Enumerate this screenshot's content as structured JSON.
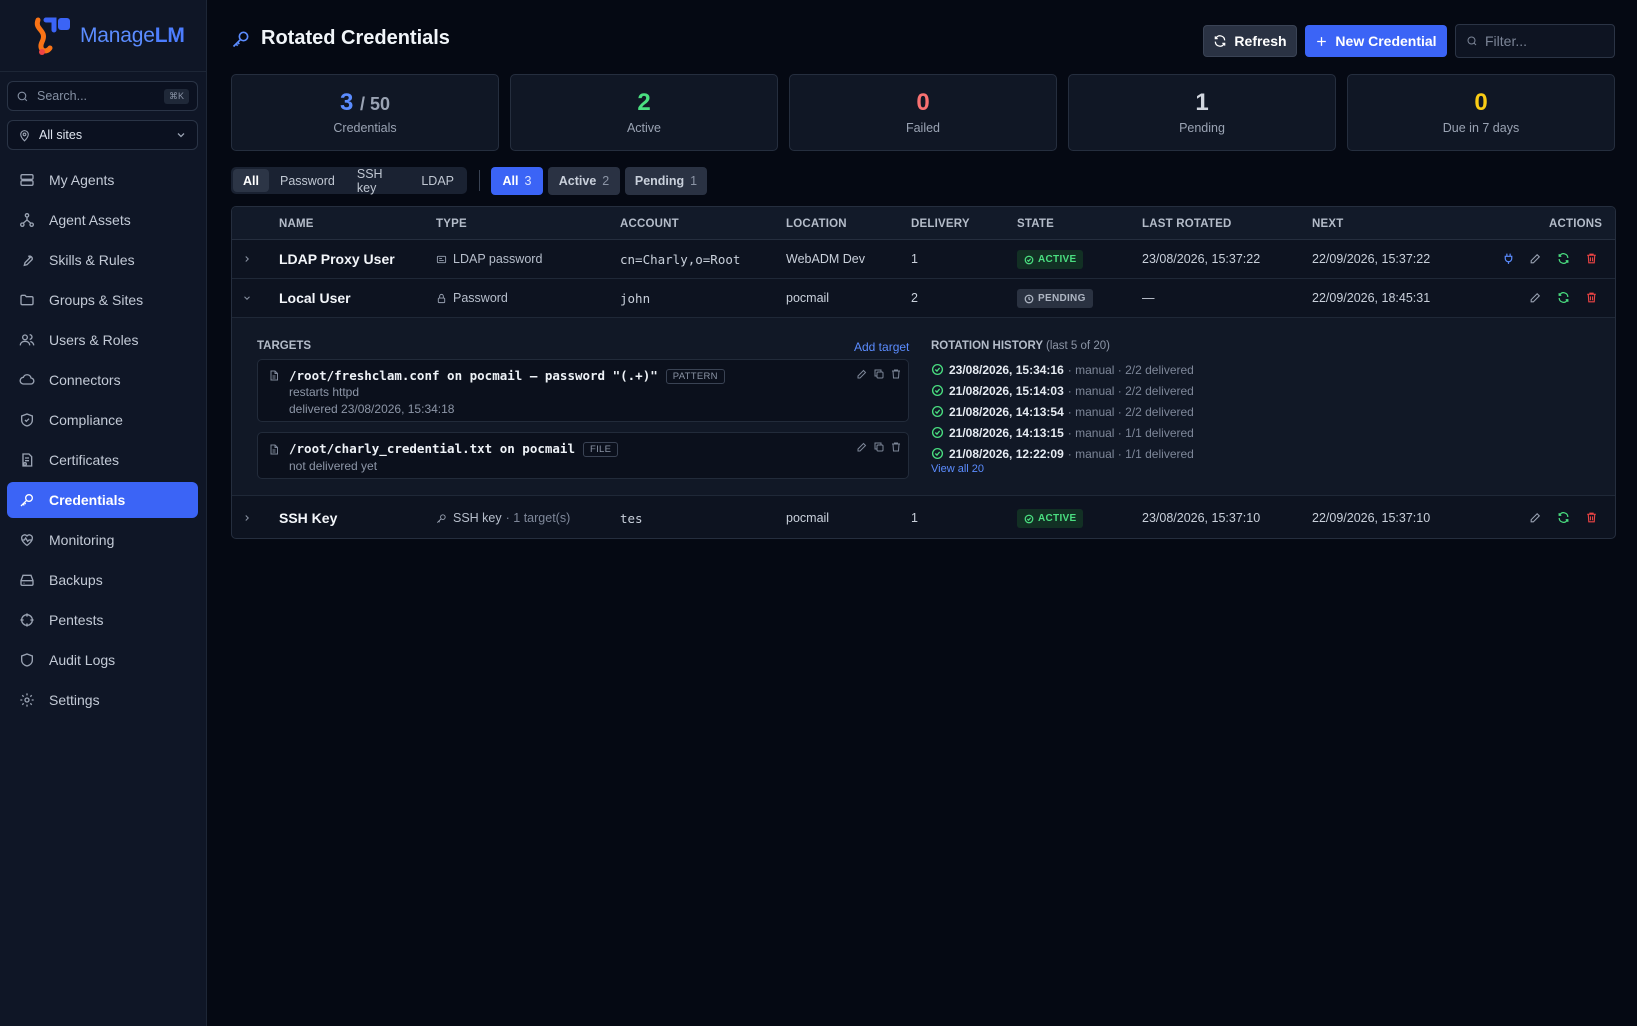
{
  "brand": {
    "name_prefix": "Manage",
    "name_suffix": "LM"
  },
  "sidebar": {
    "search_placeholder": "Search...",
    "search_shortcut": "⌘K",
    "site_select": "All sites",
    "items": [
      {
        "label": "My Agents",
        "icon": "server-icon"
      },
      {
        "label": "Agent Assets",
        "icon": "assets-icon"
      },
      {
        "label": "Skills & Rules",
        "icon": "wrench-icon"
      },
      {
        "label": "Groups & Sites",
        "icon": "folder-icon"
      },
      {
        "label": "Users & Roles",
        "icon": "users-icon"
      },
      {
        "label": "Connectors",
        "icon": "cloud-icon"
      },
      {
        "label": "Compliance",
        "icon": "shield-check-icon"
      },
      {
        "label": "Certificates",
        "icon": "certificate-icon"
      },
      {
        "label": "Credentials",
        "icon": "key-icon",
        "active": true
      },
      {
        "label": "Monitoring",
        "icon": "heart-pulse-icon"
      },
      {
        "label": "Backups",
        "icon": "hard-drive-icon"
      },
      {
        "label": "Pentests",
        "icon": "crosshair-icon"
      },
      {
        "label": "Audit Logs",
        "icon": "shield-icon"
      },
      {
        "label": "Settings",
        "icon": "gear-icon"
      }
    ]
  },
  "header": {
    "title": "Rotated Credentials",
    "refresh_label": "Refresh",
    "new_label": "New Credential",
    "filter_placeholder": "Filter..."
  },
  "stats": [
    {
      "value": "3",
      "suffix": "/ 50",
      "label": "Credentials",
      "color": "#5b8cff"
    },
    {
      "value": "2",
      "label": "Active",
      "color": "#4ade80"
    },
    {
      "value": "0",
      "label": "Failed",
      "color": "#f87171"
    },
    {
      "value": "1",
      "label": "Pending",
      "color": "#d1d6de"
    },
    {
      "value": "0",
      "label": "Due in 7 days",
      "color": "#facc15"
    }
  ],
  "type_filters": [
    "All",
    "Password",
    "SSH key",
    "LDAP"
  ],
  "state_filters": [
    {
      "label": "All",
      "count": "3"
    },
    {
      "label": "Active",
      "count": "2"
    },
    {
      "label": "Pending",
      "count": "1"
    }
  ],
  "table": {
    "columns": [
      "NAME",
      "TYPE",
      "ACCOUNT",
      "LOCATION",
      "DELIVERY",
      "STATE",
      "LAST ROTATED",
      "NEXT",
      "ACTIONS"
    ],
    "rows": [
      {
        "name": "LDAP Proxy User",
        "type": "LDAP password",
        "type_extra": "",
        "account": "cn=Charly,o=Root",
        "location": "WebADM Dev",
        "delivery": "1",
        "state": "ACTIVE",
        "last_rotated": "23/08/2026, 15:37:22",
        "next": "22/09/2026, 15:37:22"
      },
      {
        "name": "Local User",
        "type": "Password",
        "type_extra": "",
        "account": "john",
        "location": "pocmail",
        "delivery": "2",
        "state": "PENDING",
        "last_rotated": "—",
        "next": "22/09/2026, 18:45:31"
      },
      {
        "name": "SSH Key",
        "type": "SSH key",
        "type_extra": "· 1 target(s)",
        "account": "tes",
        "location": "pocmail",
        "delivery": "1",
        "state": "ACTIVE",
        "last_rotated": "23/08/2026, 15:37:10",
        "next": "22/09/2026, 15:37:10"
      }
    ]
  },
  "expanded": {
    "targets_title": "TARGETS",
    "add_target_label": "Add target",
    "targets": [
      {
        "path": "/root/freshclam.conf on pocmail — password \"(.+)\"",
        "tag": "PATTERN",
        "lines": [
          "restarts httpd",
          "delivered 23/08/2026, 15:34:18"
        ]
      },
      {
        "path": "/root/charly_credential.txt on pocmail",
        "tag": "FILE",
        "lines": [
          "not delivered yet"
        ]
      }
    ],
    "history_title": "ROTATION HISTORY",
    "history_sub": "(last 5 of 20)",
    "history": [
      {
        "time": "23/08/2026, 15:34:16",
        "detail": "· manual · 2/2 delivered"
      },
      {
        "time": "21/08/2026, 15:14:03",
        "detail": "· manual · 2/2 delivered"
      },
      {
        "time": "21/08/2026, 14:13:54",
        "detail": "· manual · 2/2 delivered"
      },
      {
        "time": "21/08/2026, 14:13:15",
        "detail": "· manual · 1/1 delivered"
      },
      {
        "time": "21/08/2026, 12:22:09",
        "detail": "· manual · 1/1 delivered"
      }
    ],
    "view_all_label": "View all 20"
  }
}
